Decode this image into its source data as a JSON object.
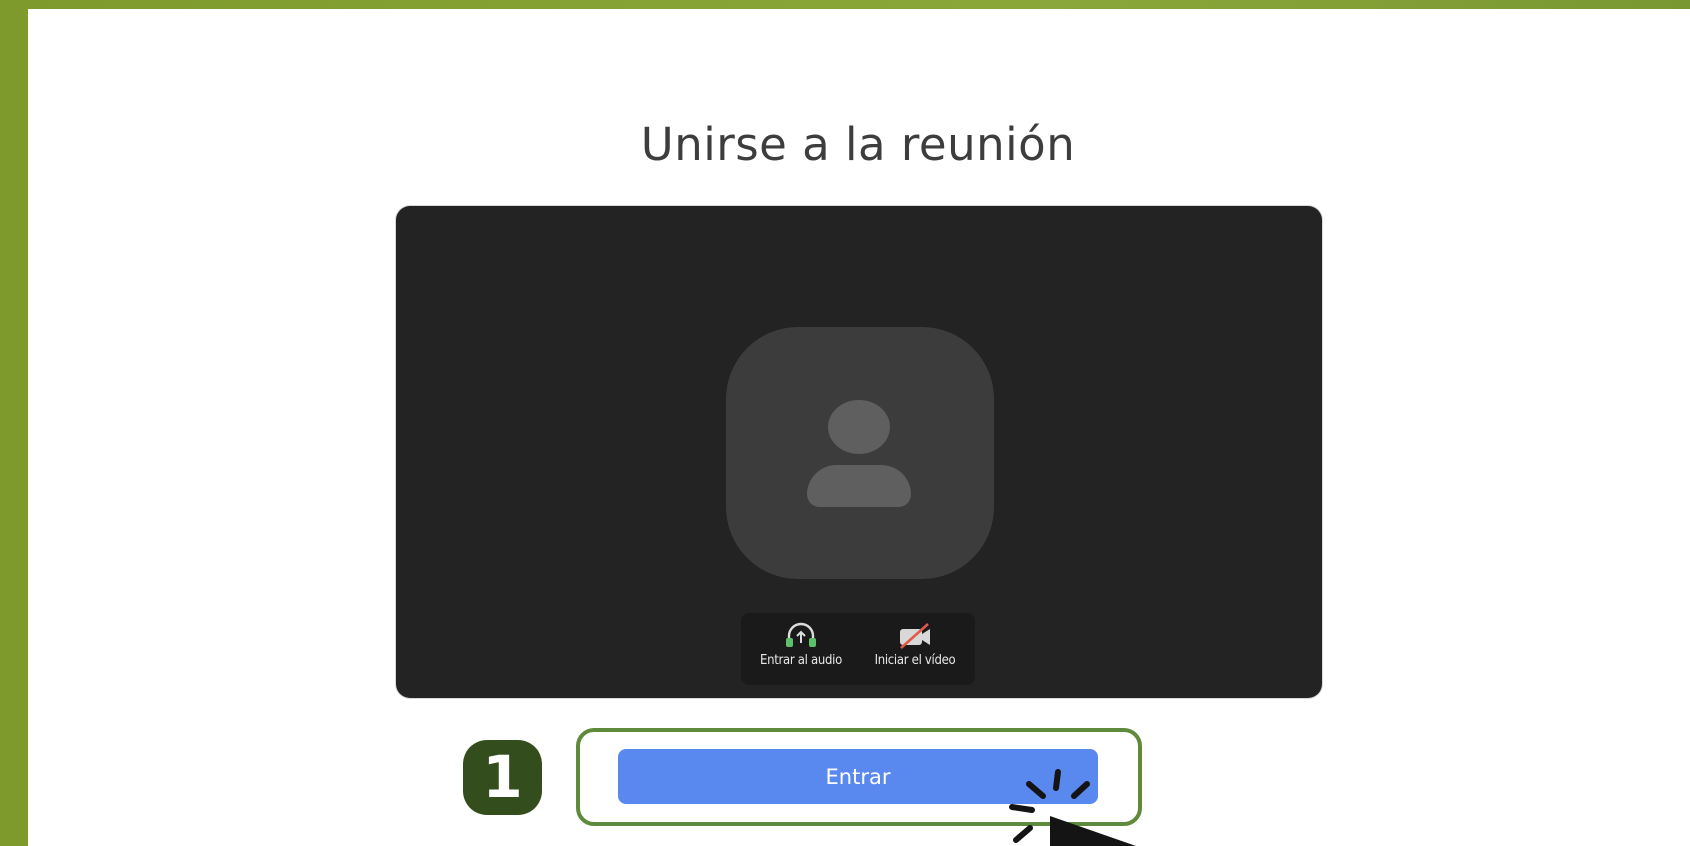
{
  "meeting": {
    "title": "Unirse a la reunión",
    "controls": {
      "audio_label": "Entrar al audio",
      "video_label": "Iniciar el vídeo"
    },
    "join_button_label": "Entrar"
  },
  "annotation": {
    "step_number": "1"
  },
  "icons": {
    "avatar": "user-placeholder-icon",
    "audio": "headphones-icon",
    "video": "video-off-icon",
    "cursor": "click-cursor-icon"
  },
  "colors": {
    "frame_green": "#8aa83a",
    "preview_bg": "#232323",
    "join_button": "#5988ef",
    "highlight_border": "#5f8a3c",
    "badge_bg": "#344d1c",
    "audio_icon": "#5ec06a",
    "video_icon_slash": "#e05a4a"
  }
}
